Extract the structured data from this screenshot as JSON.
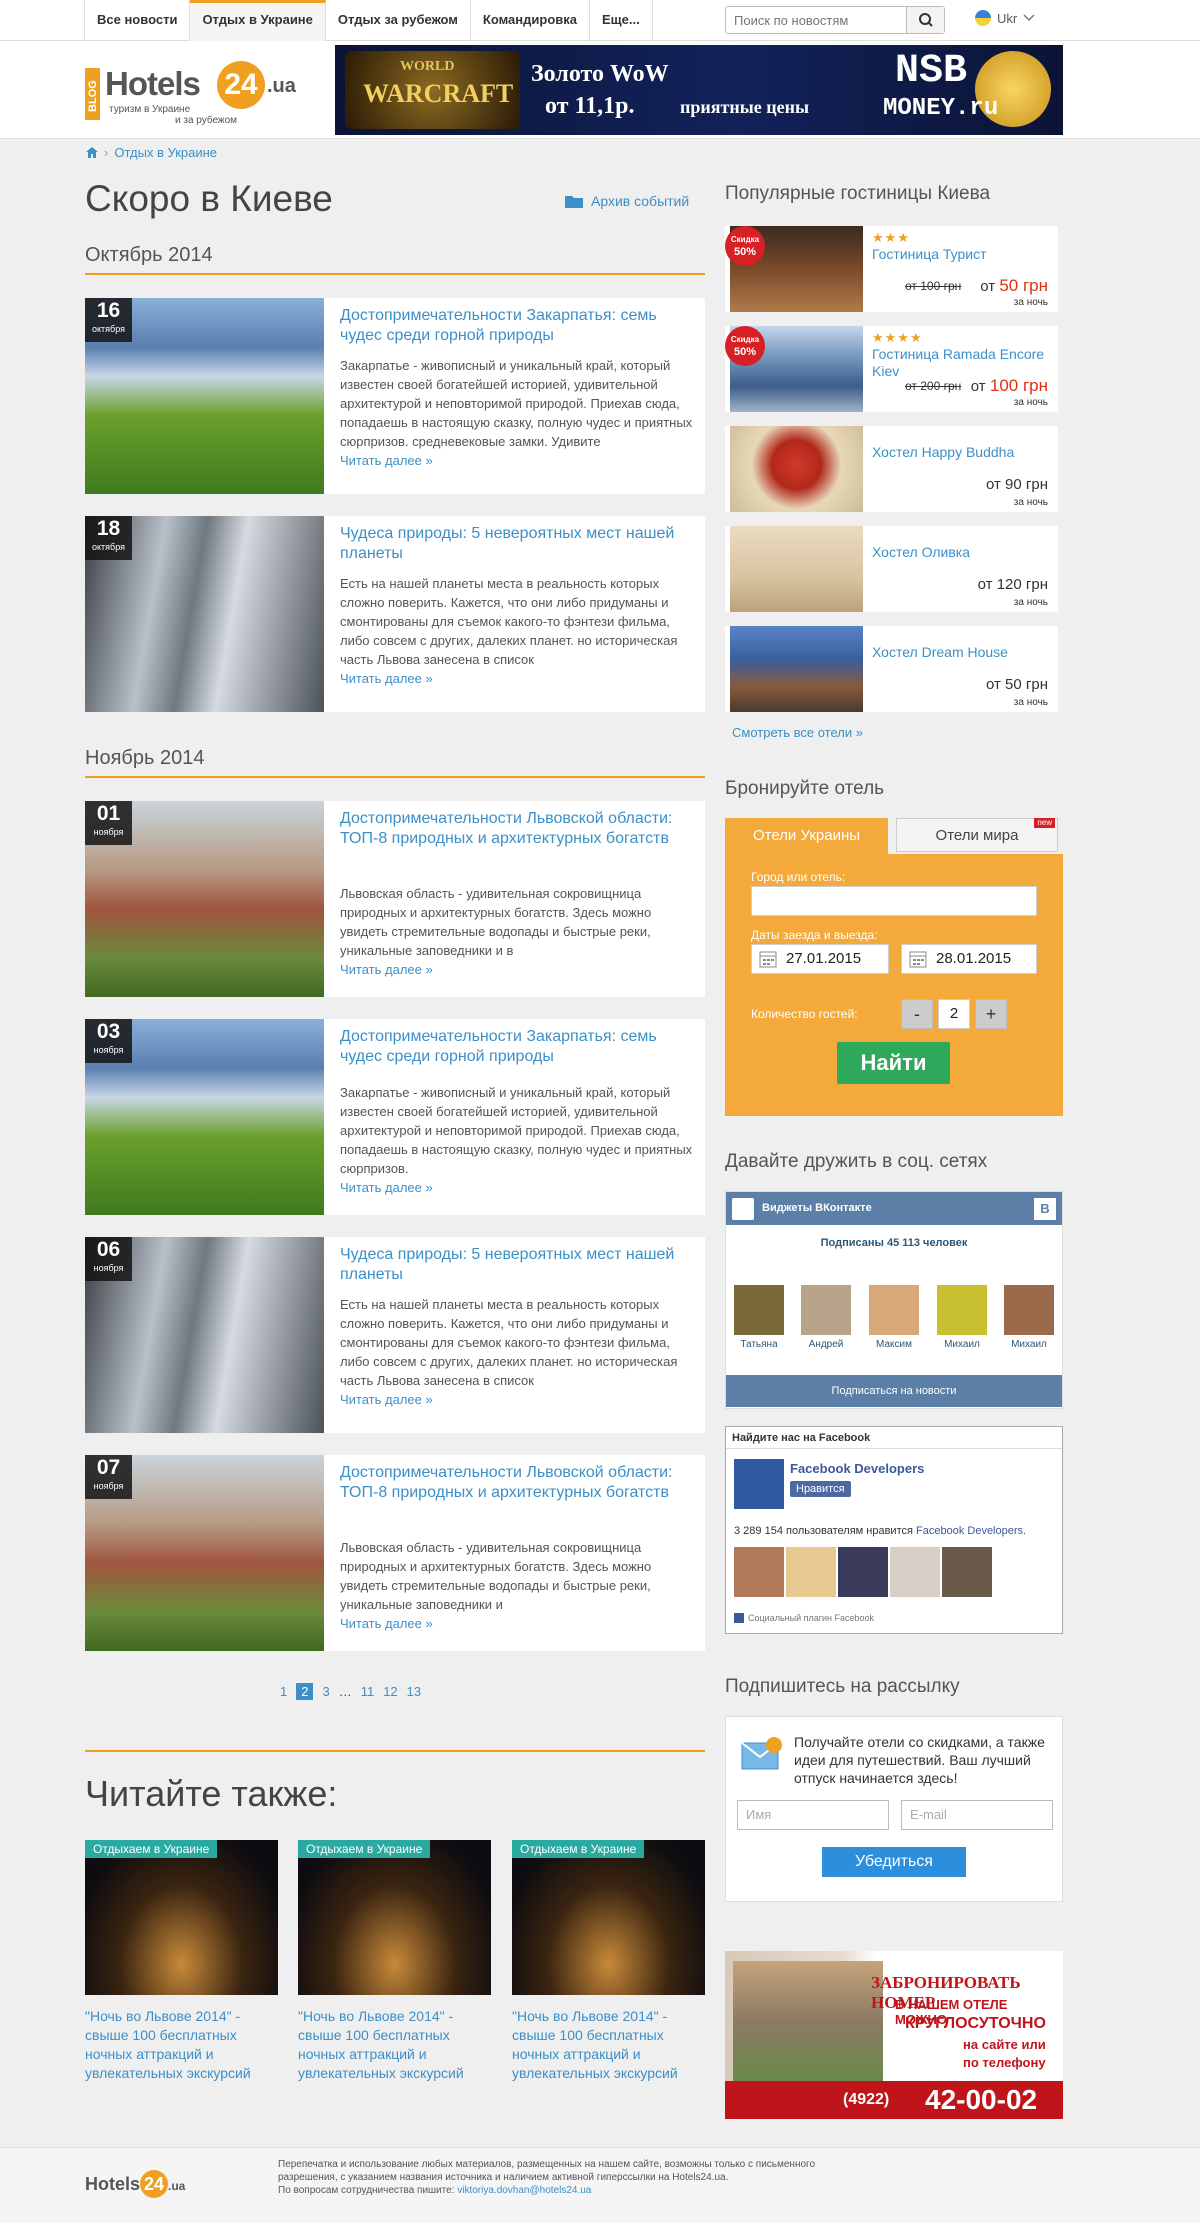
{
  "nav": {
    "tabs": [
      "Все новости",
      "Отдых в Украине",
      "Отдых за рубежом",
      "Командировка",
      "Еще..."
    ],
    "search_placeholder": "Поиск по новостям",
    "lang": "Ukr"
  },
  "logo": {
    "blog": "BLOG",
    "name": "Hotels",
    "num": "24",
    "domain": ".ua",
    "tagline1": "туризм в Украине",
    "tagline2": "и за рубежом"
  },
  "banner": {
    "game1": "WORLD",
    "game2": "WARCRAFT",
    "promo1": "Золото WoW",
    "promo2": "от 11,1р.",
    "promo3": "приятные цены",
    "brand1": "NSB",
    "brand2": "MONEY.ru"
  },
  "breadcrumb": {
    "section": "Отдых в Украине"
  },
  "page_title": "Скоро в Киеве",
  "archive_link": "Архив событий",
  "months": [
    "Октябрь 2014",
    "Ноябрь 2014"
  ],
  "read_more": "Читать далее »",
  "articles": [
    {
      "day": "16",
      "month": "октября",
      "title": "Достопримечательности Закарпатья: семь чудес среди горной природы",
      "text": "Закарпатье - живописный и уникальный край, который известен своей богатейшей историей, удивительной архитектурой и неповторимой природой. Приехав сюда, попадаешь в настоящую сказку, полную чудес и приятных сюрпризов. средневековые замки. Удивите"
    },
    {
      "day": "18",
      "month": "октября",
      "title": "Чудеса природы: 5 невероятных мест нашей планеты",
      "text": "Есть на нашей планеты места в реальность которых сложно поверить. Кажется, что они либо придуманы и смонтированы для съемок какого-то фэнтези фильма, либо совсем с других, далеких планет. но историческая часть Львова занесена в список"
    },
    {
      "day": "01",
      "month": "ноября",
      "title": "Достопримечательности Львовской области: ТОП-8 природных и архитектурных богатств",
      "text": "Львовская область - удивительная сокровищница природных и архитектурных богатств. Здесь можно увидеть стремительные водопады и быстрые реки, уникальные заповедники и в"
    },
    {
      "day": "03",
      "month": "ноября",
      "title": "Достопримечательности Закарпатья: семь чудес среди горной природы",
      "text": "Закарпатье - живописный и уникальный край, который известен своей богатейшей историей, удивительной архитектурой и неповторимой природой. Приехав сюда, попадаешь в настоящую сказку, полную чудес и приятных сюрпризов."
    },
    {
      "day": "06",
      "month": "ноября",
      "title": "Чудеса природы: 5 невероятных мест нашей планеты",
      "text": "Есть на нашей планеты места в реальность которых сложно поверить. Кажется, что они либо придуманы и смонтированы для съемок какого-то фэнтези фильма, либо совсем с других, далеких планет. но историческая часть Львова занесена в список"
    },
    {
      "day": "07",
      "month": "ноября",
      "title": "Достопримечательности Львовской области: ТОП-8 природных и архитектурных богатств",
      "text": "Львовская область - удивительная сокровищница природных и архитектурных богатств. Здесь можно увидеть стремительные водопады и быстрые реки, уникальные заповедники и"
    }
  ],
  "pagination": [
    "1",
    "2",
    "3",
    "…",
    "11",
    "12",
    "13"
  ],
  "also": {
    "heading": "Читайте также:",
    "items": [
      {
        "tag": "Отдыхаем в Украине",
        "title": "\"Ночь во Львове 2014\" - свыше 100 бесплатных ночных аттракций и увлекательных экскурсий"
      },
      {
        "tag": "Отдыхаем в Украине",
        "title": "\"Ночь во Львове 2014\" - свыше 100 бесплатных ночных аттракций и увлекательных экскурсий"
      },
      {
        "tag": "Отдыхаем в Украине",
        "title": "\"Ночь во Львове 2014\" - свыше 100 бесплатных ночных аттракций и увлекательных экскурсий"
      }
    ]
  },
  "popular": {
    "heading": "Популярные гостиницы Киева",
    "sale_label1": "Скидка",
    "sale_label2": "50%",
    "per_night": "за ночь",
    "from": "от",
    "hotels": [
      {
        "name": "Гостиница Турист",
        "stars": "★★★",
        "old": "от 100 грн",
        "price": "50 грн"
      },
      {
        "name": "Гостиница Ramada Encore Kiev",
        "stars": "★★★★",
        "old": "от 200 грн",
        "price": "100 грн"
      },
      {
        "name": "Хостел Happy Buddha",
        "price": "90 грн"
      },
      {
        "name": "Хостел Оливка",
        "price": "120 грн"
      },
      {
        "name": "Хостел Dream House",
        "price": "50 грн"
      }
    ],
    "all_link": "Смотреть все отели »"
  },
  "booking": {
    "heading": "Бронируйте отель",
    "tab_ua": "Отели Украины",
    "tab_world": "Отели мира",
    "new_badge": "new",
    "city_label": "Город или отель:",
    "dates_label": "Даты заезда и выезда:",
    "date_in": "27.01.2015",
    "date_out": "28.01.2015",
    "guests_label": "Количество гостей:",
    "minus": "-",
    "guests": "2",
    "plus": "+",
    "submit": "Найти"
  },
  "social": {
    "heading": "Давайте дружить в соц. сетях",
    "vk_title": "Виджеты ВКонтакте",
    "vk_count": "Подписаны 45 113 человек",
    "vk_users": [
      "Татьяна",
      "Андрей",
      "Максим",
      "Михаил",
      "Михаил"
    ],
    "vk_subscribe": "Подписаться на новости",
    "fb_title": "Найдите нас на Facebook",
    "fb_page": "Facebook Developers",
    "fb_like": "Нравится",
    "fb_count": "3 289 154 пользователям нравится",
    "fb_count_page": "Facebook Developers.",
    "fb_plugin": "Социальный плагин Facebook"
  },
  "newsletter": {
    "heading": "Подпишитесь на рассылку",
    "text": "Получайте отели со скидками, а также идеи для путешествий. Ваш лучший отпуск начинается здесь!",
    "name_placeholder": "Имя",
    "email_placeholder": "E-mail",
    "submit": "Убедиться"
  },
  "ad2": {
    "line1": "ЗАБРОНИРОВАТЬ НОМЕР",
    "line2": "В НАШЕМ ОТЕЛЕ МОЖНО",
    "line3": "КРУГЛОСУТОЧНО",
    "line4": "на сайте или",
    "line5": "по телефону",
    "code": "(4922)",
    "phone": "42-00-02"
  },
  "footer": {
    "text": "Перепечатка и использование любых материалов, размещенных на нашем сайте, возможны только с письменного разрешения, с указанием названия источника и наличием активной гиперссылки на Hotels24.ua.",
    "contact": "По вопросам сотрудничества пишите:",
    "email": "viktoriya.dovhan@hotels24.ua"
  },
  "colors": {
    "accent": "#f0a020",
    "link": "#3c8fc7",
    "booking": "#f4a93b",
    "find": "#2ea85a",
    "vk": "#5b7fa6"
  }
}
